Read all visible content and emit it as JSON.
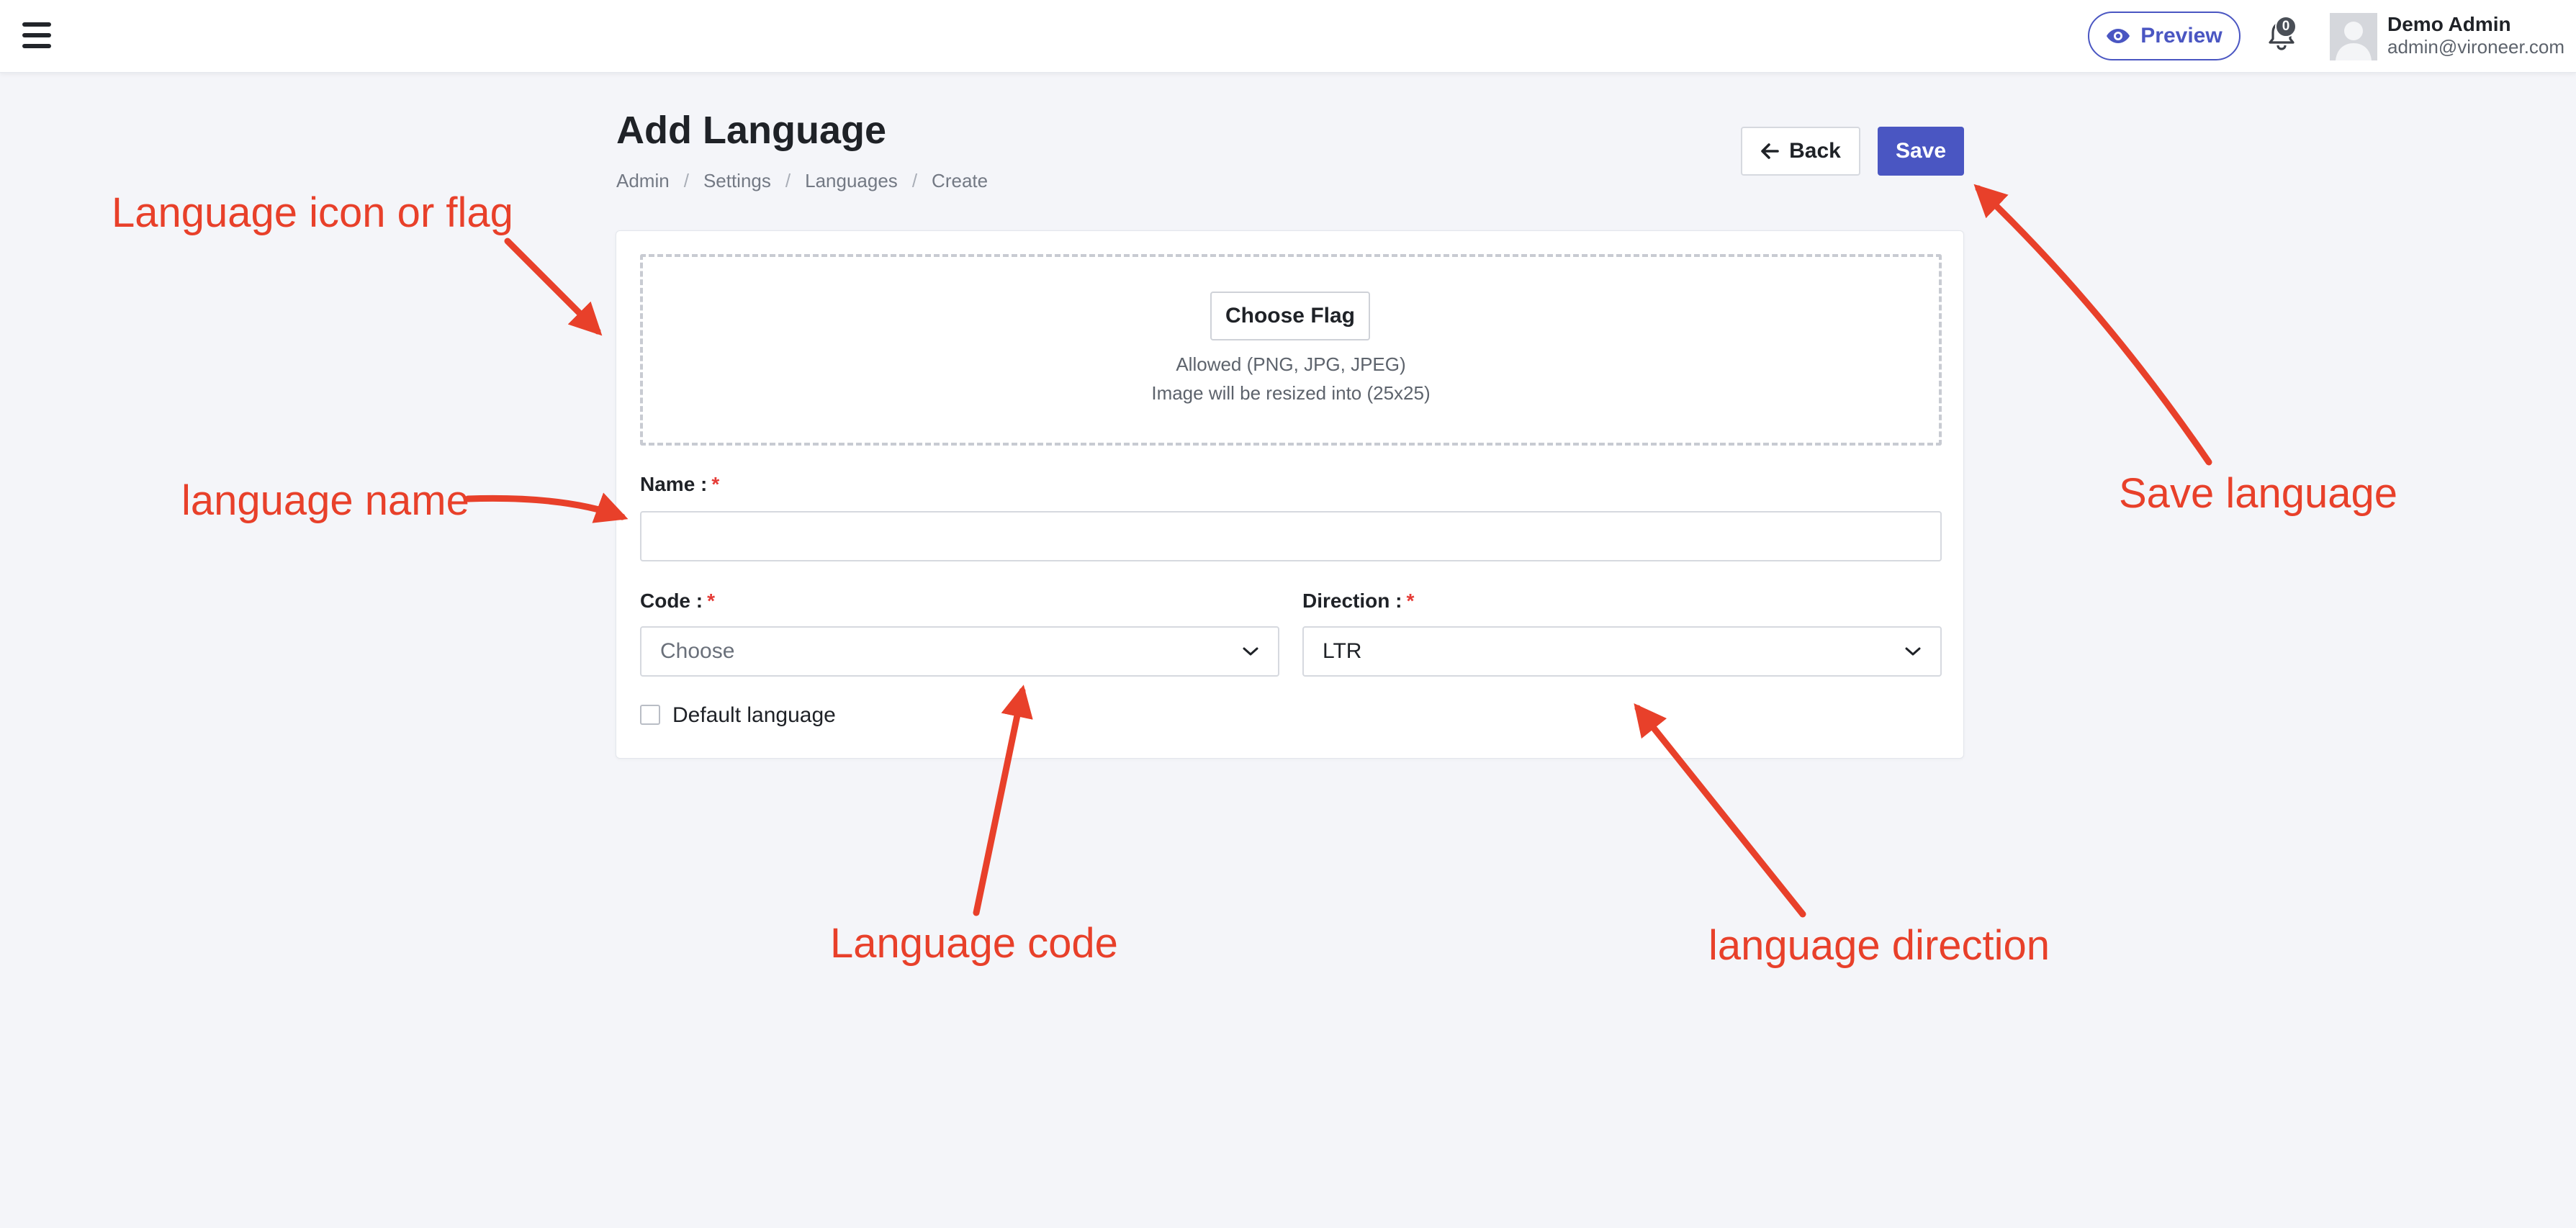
{
  "topbar": {
    "menu_icon": "hamburger-menu-icon",
    "preview_label": "Preview",
    "notification_count": "0",
    "user": {
      "name": "Demo Admin",
      "email": "admin@vironeer.com"
    }
  },
  "page": {
    "title": "Add Language",
    "breadcrumb": [
      "Admin",
      "Settings",
      "Languages",
      "Create"
    ],
    "back_label": "Back",
    "save_label": "Save"
  },
  "form": {
    "flag": {
      "button_label": "Choose Flag",
      "hint_line1": "Allowed (PNG, JPG, JPEG)",
      "hint_line2": "Image will be resized into (25x25)"
    },
    "name": {
      "label": "Name :",
      "required": "*",
      "value": "",
      "placeholder": ""
    },
    "code": {
      "label": "Code :",
      "required": "*",
      "selected": "Choose"
    },
    "direction": {
      "label": "Direction :",
      "required": "*",
      "selected": "LTR"
    },
    "default_language_label": "Default language",
    "default_language_checked": false
  },
  "annotations": {
    "flag": "Language icon or flag",
    "name": "language name",
    "code": "Language code",
    "direction": "language direction",
    "save": "Save language"
  },
  "colors": {
    "accent": "#4a56c2",
    "annotation": "#e8402a",
    "required": "#e53b36",
    "background": "#f4f5f9"
  }
}
